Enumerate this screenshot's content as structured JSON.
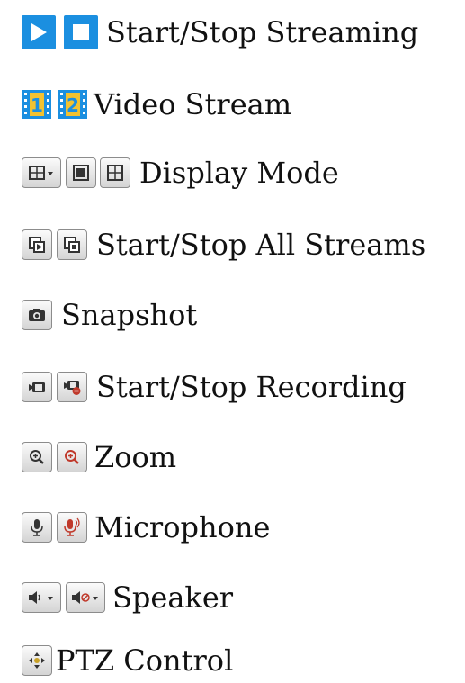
{
  "items": [
    {
      "label": "Start/Stop Streaming"
    },
    {
      "label": "Video Stream"
    },
    {
      "label": "Display Mode"
    },
    {
      "label": "Start/Stop All Streams"
    },
    {
      "label": "Snapshot"
    },
    {
      "label": "Start/Stop Recording"
    },
    {
      "label": "Zoom"
    },
    {
      "label": "Microphone"
    },
    {
      "label": "Speaker"
    },
    {
      "label": "PTZ Control"
    }
  ],
  "icon_text": {
    "stream1": "1",
    "stream2": "2"
  },
  "colors": {
    "accent_blue": "#1b8fe0",
    "record_red": "#c0392b"
  }
}
